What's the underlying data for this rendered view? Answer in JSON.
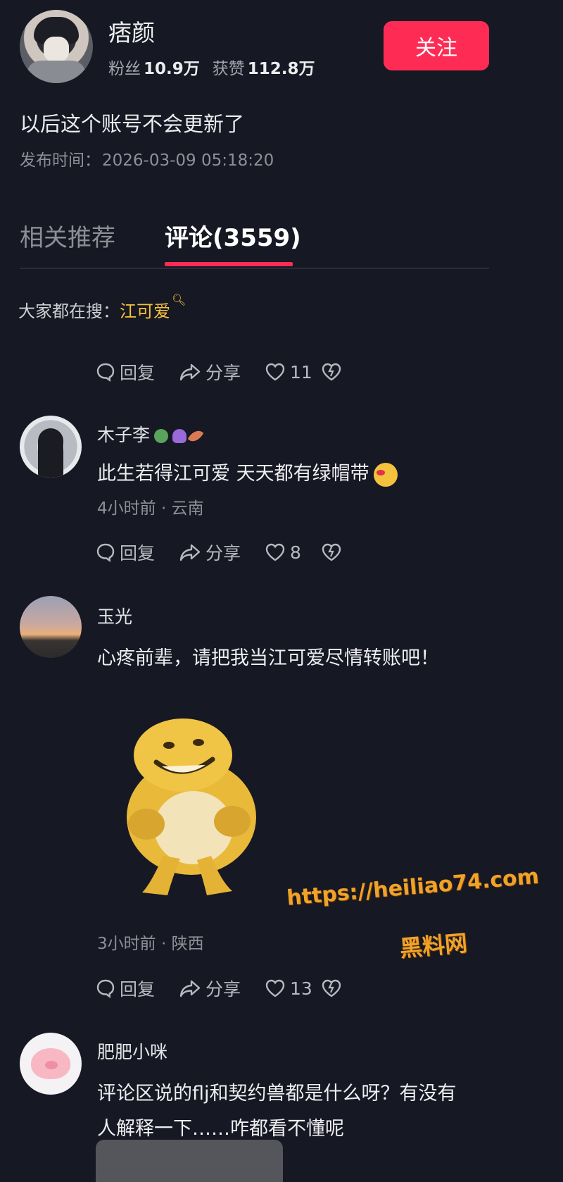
{
  "author": {
    "name": "痞颜",
    "followers_label": "粉丝",
    "followers_value": "10.9万",
    "likes_label": "获赞",
    "likes_value": "112.8万",
    "follow_label": "关注"
  },
  "post": {
    "text": "以后这个账号不会更新了",
    "time_label": "发布时间：",
    "time_value": "2026-03-09 05:18:20"
  },
  "tabs": [
    {
      "label": "相关推荐"
    },
    {
      "label": "评论(3559)"
    }
  ],
  "search_hint": {
    "label": "大家都在搜：",
    "term": "江可爱"
  },
  "actions_labels": {
    "reply": "回复",
    "share": "分享"
  },
  "action_rows": [
    {
      "likes": "11"
    },
    {
      "likes": "8"
    },
    {
      "likes": "13"
    }
  ],
  "comments": [
    {
      "name": "木子李",
      "text": "此生若得江可爱 天天都有绿帽带",
      "meta": "4小时前 · 云南"
    },
    {
      "name": "玉光",
      "text": "心疼前辈，请把我当江可爱尽情转账吧！",
      "meta": "3小时前 · 陕西"
    },
    {
      "name": "肥肥小咪",
      "text_line1": "评论区说的flj和契约兽都是什么呀？有没有",
      "text_line2": "人解释一下……咋都看不懂呢"
    }
  ],
  "watermark": {
    "url": "https://heiliao74.com",
    "name": "黑料网"
  },
  "colors": {
    "background": "#161823",
    "accent": "#fe2c55",
    "search_term": "#f6c23b",
    "watermark": "#f0a22a"
  }
}
